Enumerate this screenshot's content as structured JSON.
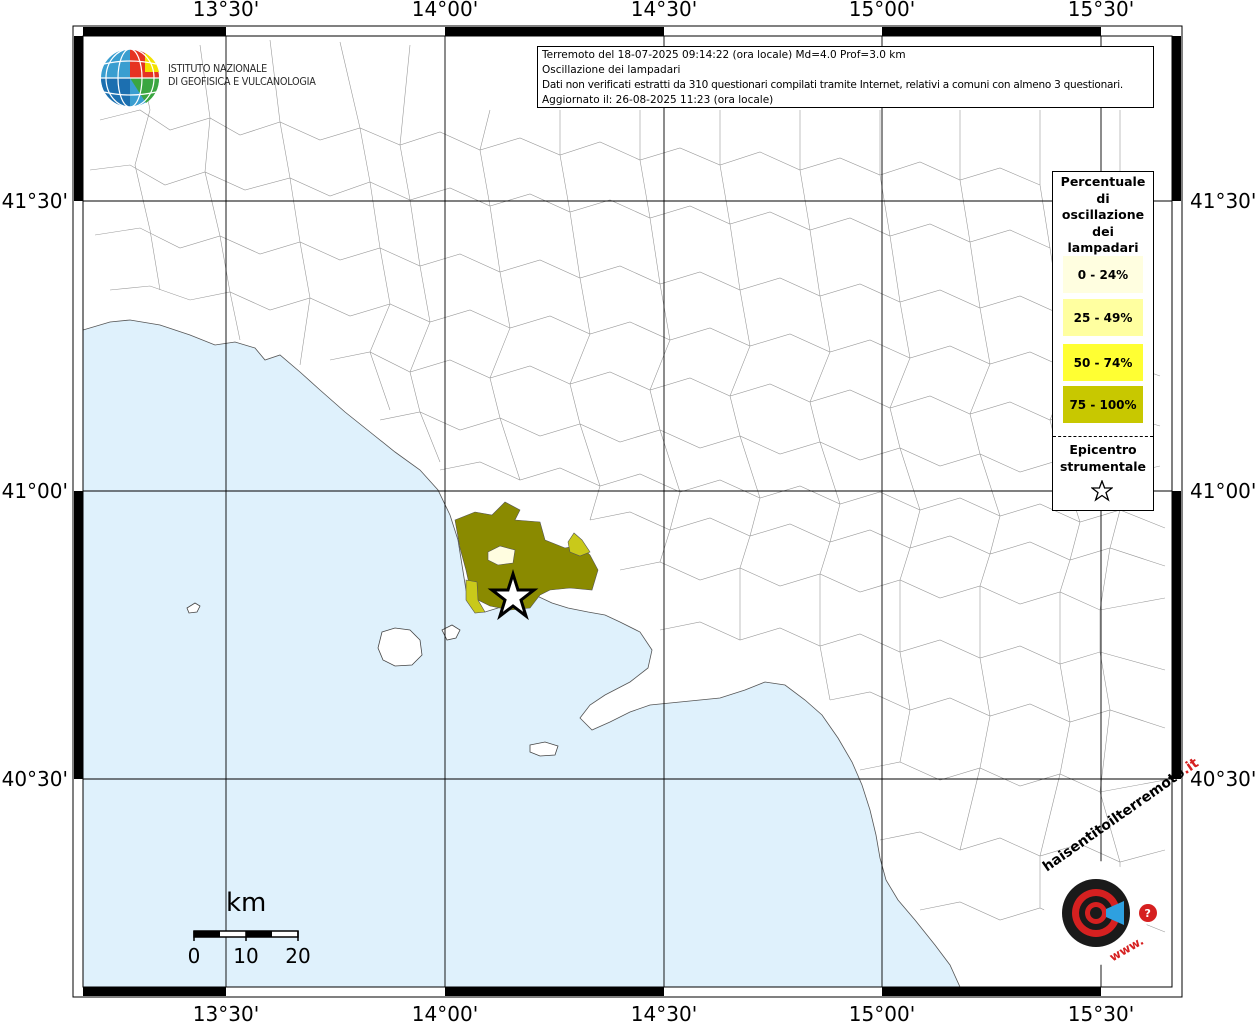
{
  "info": {
    "line1": "Terremoto del 18-07-2025 09:14:22 (ora locale) Md=4.0 Prof=3.0 km",
    "line2": "Oscillazione dei lampadari",
    "line3": "Dati non verificati estratti da 310 questionari compilati tramite Internet, relativi a comuni con almeno 3 questionari.",
    "line4": "Aggiornato il: 26-08-2025 11:23 (ora locale)"
  },
  "institute": {
    "line1": "ISTITUTO NAZIONALE",
    "line2": "DI GEOFISICA E VULCANOLOGIA"
  },
  "longitude_labels": [
    "13°30'",
    "14°00'",
    "14°30'",
    "15°00'",
    "15°30'"
  ],
  "latitude_labels": [
    "41°30'",
    "41°00'",
    "40°30'"
  ],
  "legend": {
    "title_lines": [
      "Percentuale",
      "di",
      "oscillazione",
      "dei",
      "lampadari"
    ],
    "classes": [
      {
        "label": "0 - 24%",
        "color": "#fffee0"
      },
      {
        "label": "25 - 49%",
        "color": "#ffffa0"
      },
      {
        "label": "50 - 74%",
        "color": "#ffff33"
      },
      {
        "label": "75 - 100%",
        "color": "#c8c800"
      }
    ],
    "epicenter_lines": [
      "Epicentro",
      "strumentale"
    ]
  },
  "scale_bar": {
    "unit": "km",
    "ticks": [
      "0",
      "10",
      "20"
    ]
  },
  "map_colors": {
    "sea": "#dff1fc",
    "land": "#ffffff",
    "affected_high": "#8a8a00",
    "affected_mid": "#c9c91a",
    "affected_low": "#fffde0"
  },
  "logo_haisentito": {
    "text_top": "haisentitoilterremoto",
    "text_it": ".it",
    "text_bottom": "www."
  }
}
